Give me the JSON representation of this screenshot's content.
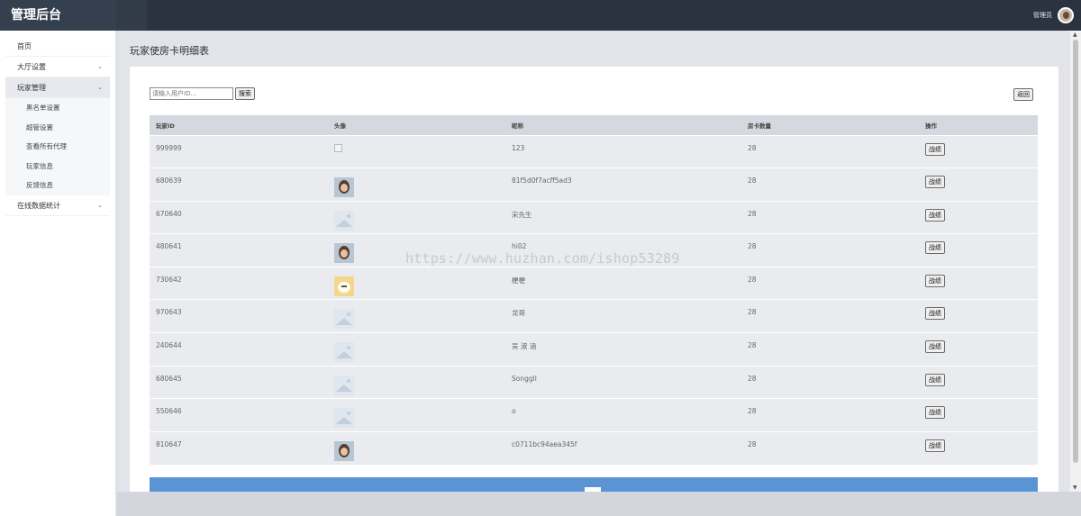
{
  "header": {
    "brand": "管理后台",
    "user_name": "管理员"
  },
  "sidebar": {
    "items": [
      {
        "label": "首页",
        "has_children": false
      },
      {
        "label": "大厅设置",
        "has_children": true,
        "chevron": "⌄"
      },
      {
        "label": "玩家管理",
        "has_children": true,
        "chevron": "⌄",
        "active": true,
        "children": [
          "黑名单设置",
          "超管设置",
          "查看所有代理",
          "玩家信息",
          "反馈信息"
        ]
      },
      {
        "label": "在线数据统计",
        "has_children": true,
        "chevron": "⌄"
      }
    ]
  },
  "page": {
    "title": "玩家使房卡明细表",
    "search_placeholder": "请输入用户ID...",
    "search_button": "搜索",
    "back_button": "返回"
  },
  "table": {
    "columns": [
      "玩家ID",
      "头像",
      "昵称",
      "房卡数量",
      "操作"
    ],
    "action_label": "战绩",
    "rows": [
      {
        "id": "999999",
        "avatar": "broken-image-icon",
        "nickname": "123",
        "cards": "28"
      },
      {
        "id": "680639",
        "avatar": "face-photo-avatar",
        "nickname": "81f5d0f7acff5ad3",
        "cards": "28"
      },
      {
        "id": "670640",
        "avatar": "placeholder-image-icon",
        "nickname": "宋先生",
        "cards": "28"
      },
      {
        "id": "480641",
        "avatar": "face-photo-avatar",
        "nickname": "hi02",
        "cards": "28"
      },
      {
        "id": "730642",
        "avatar": "cartoon-avatar",
        "nickname": "梗梗",
        "cards": "28"
      },
      {
        "id": "970643",
        "avatar": "placeholder-image-icon",
        "nickname": "龙哥",
        "cards": "28"
      },
      {
        "id": "240644",
        "avatar": "placeholder-image-icon",
        "nickname": "吴 淑 涵",
        "cards": "28"
      },
      {
        "id": "680645",
        "avatar": "placeholder-image-icon",
        "nickname": "Songgll",
        "cards": "28"
      },
      {
        "id": "550646",
        "avatar": "placeholder-image-icon",
        "nickname": "o",
        "cards": "28"
      },
      {
        "id": "810647",
        "avatar": "face-photo-avatar",
        "nickname": "c0711bc94aea345f",
        "cards": "28"
      }
    ]
  },
  "watermark": "https://www.huzhan.com/ishop53289",
  "scrollbar": {
    "up": "▲",
    "down": "▼"
  },
  "colors": {
    "topbar": "#2b3340",
    "brand_bg": "#35404f",
    "pager": "#5b94d5",
    "table_header": "#d5d8de",
    "row_bg": "#e9ebee"
  }
}
